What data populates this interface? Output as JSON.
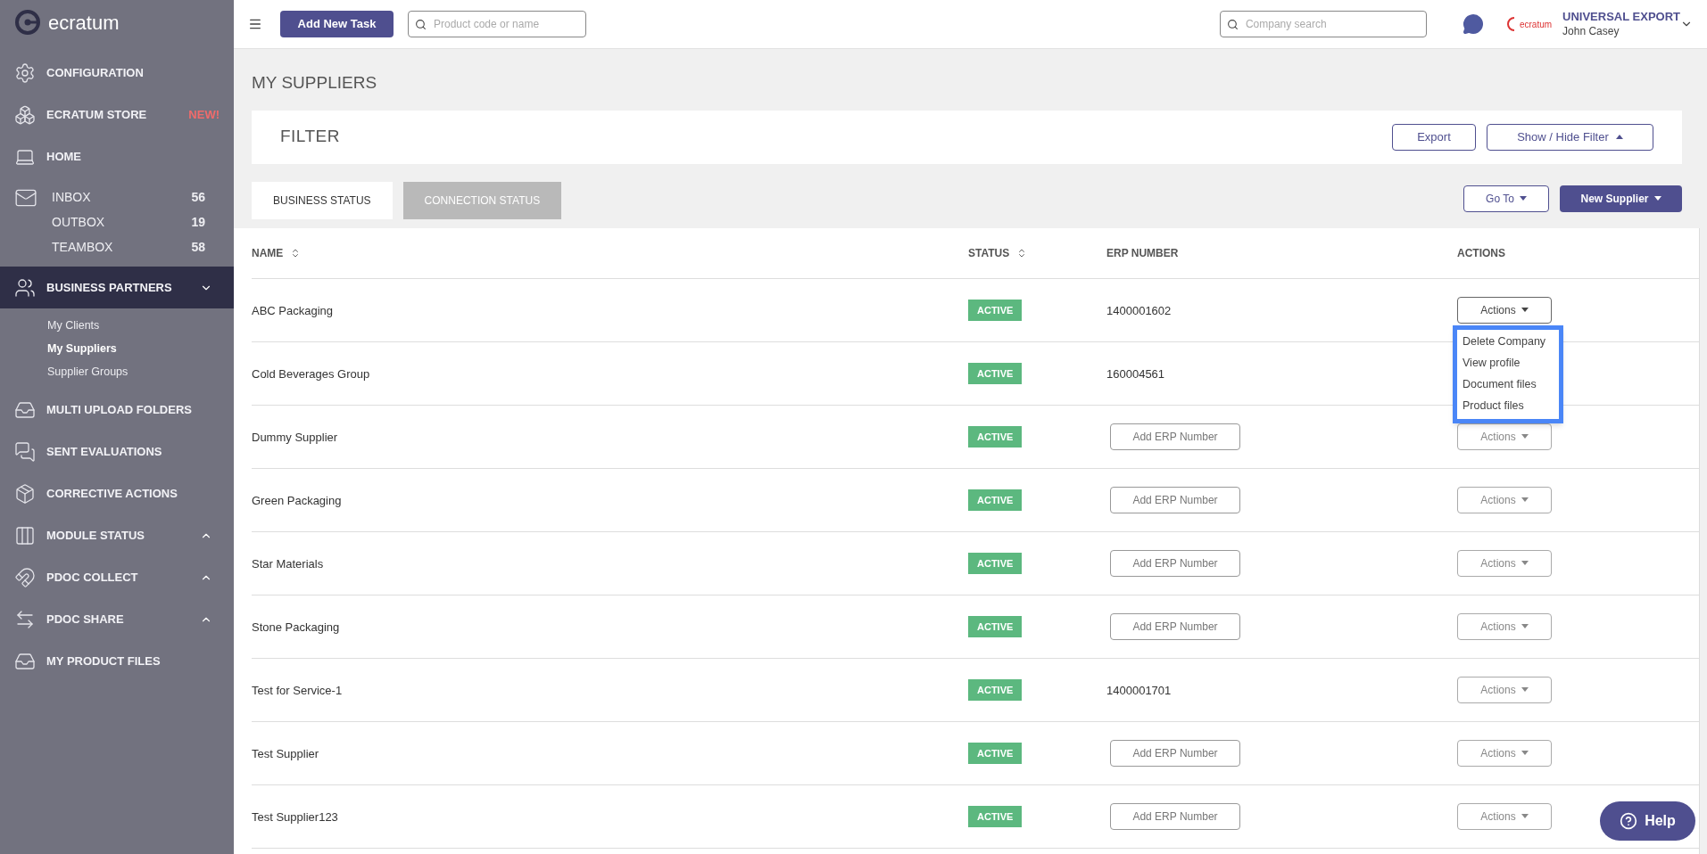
{
  "sidebar": {
    "logo": "ecratum",
    "items": [
      {
        "kind": "item",
        "label": "CONFIGURATION",
        "selected": false
      },
      {
        "kind": "item",
        "label": "ECRATUM STORE",
        "badge": "NEW!",
        "selected": false
      },
      {
        "kind": "item",
        "label": "HOME",
        "selected": false
      },
      {
        "kind": "mail",
        "boxes": [
          {
            "label": "INBOX",
            "count": "56"
          },
          {
            "label": "OUTBOX",
            "count": "19"
          },
          {
            "label": "TEAMBOX",
            "count": "58"
          }
        ]
      },
      {
        "kind": "group",
        "label": "BUSINESS PARTNERS",
        "selected": true,
        "expanded": true,
        "children": [
          {
            "label": "My Clients",
            "selected": false
          },
          {
            "label": "My Suppliers",
            "selected": true
          },
          {
            "label": "Supplier Groups",
            "selected": false
          }
        ]
      },
      {
        "kind": "item",
        "label": "MULTI UPLOAD FOLDERS",
        "selected": false
      },
      {
        "kind": "item",
        "label": "SENT EVALUATIONS",
        "selected": false
      },
      {
        "kind": "item",
        "label": "CORRECTIVE ACTIONS",
        "selected": false
      },
      {
        "kind": "group",
        "label": "MODULE STATUS",
        "selected": false,
        "expanded": false
      },
      {
        "kind": "group",
        "label": "PDOC COLLECT",
        "selected": false,
        "expanded": false
      },
      {
        "kind": "group",
        "label": "PDOC SHARE",
        "selected": false,
        "expanded": false
      },
      {
        "kind": "item",
        "label": "MY PRODUCT FILES",
        "selected": false
      }
    ]
  },
  "topbar": {
    "add_task": "Add New Task",
    "product_search": {
      "placeholder": "Product code or name"
    },
    "company_search": {
      "placeholder": "Company search"
    },
    "company": "UNIVERSAL EXPORT",
    "user": "John Casey",
    "logo_text": "ecratum"
  },
  "page": {
    "title": "MY SUPPLIERS",
    "filter": {
      "title": "FILTER",
      "export": "Export",
      "toggle": "Show / Hide Filter"
    },
    "tabs": [
      {
        "label": "BUSINESS STATUS",
        "selected": true
      },
      {
        "label": "CONNECTION STATUS",
        "selected": false
      }
    ],
    "goto": "Go To",
    "new_supplier": "New Supplier"
  },
  "table": {
    "columns": [
      {
        "label": "NAME",
        "sortable": true
      },
      {
        "label": "STATUS",
        "sortable": true
      },
      {
        "label": "ERP NUMBER",
        "sortable": false
      },
      {
        "label": "ACTIONS",
        "sortable": false
      }
    ],
    "rows": [
      {
        "name": "ABC Packaging",
        "status": "ACTIVE",
        "erp": {
          "kind": "text",
          "value": "1400001602"
        },
        "actions": "Actions"
      },
      {
        "name": "Cold Beverages Group",
        "status": "ACTIVE",
        "erp": {
          "kind": "text",
          "value": "160004561"
        }
      },
      {
        "name": "Dummy Supplier",
        "status": "ACTIVE",
        "erp": {
          "kind": "field",
          "placeholder": "Add ERP Number"
        },
        "actions": "Actions"
      },
      {
        "name": "Green Packaging",
        "status": "ACTIVE",
        "erp": {
          "kind": "field",
          "placeholder": "Add ERP Number"
        },
        "actions": "Actions"
      },
      {
        "name": "Star Materials",
        "status": "ACTIVE",
        "erp": {
          "kind": "field",
          "placeholder": "Add ERP Number"
        },
        "actions": "Actions"
      },
      {
        "name": "Stone Packaging",
        "status": "ACTIVE",
        "erp": {
          "kind": "field",
          "placeholder": "Add ERP Number"
        },
        "actions": "Actions"
      },
      {
        "name": "Test for Service-1",
        "status": "ACTIVE",
        "erp": {
          "kind": "text",
          "value": "1400001701"
        },
        "actions": "Actions"
      },
      {
        "name": "Test Supplier",
        "status": "ACTIVE",
        "erp": {
          "kind": "field",
          "placeholder": "Add ERP Number"
        },
        "actions": "Actions"
      },
      {
        "name": "Test Supplier123",
        "status": "ACTIVE",
        "erp": {
          "kind": "field",
          "placeholder": "Add ERP Number"
        },
        "actions": "Actions"
      }
    ],
    "menu": [
      "Delete Company",
      "View profile",
      "Document files",
      "Product files"
    ]
  },
  "help": "Help"
}
